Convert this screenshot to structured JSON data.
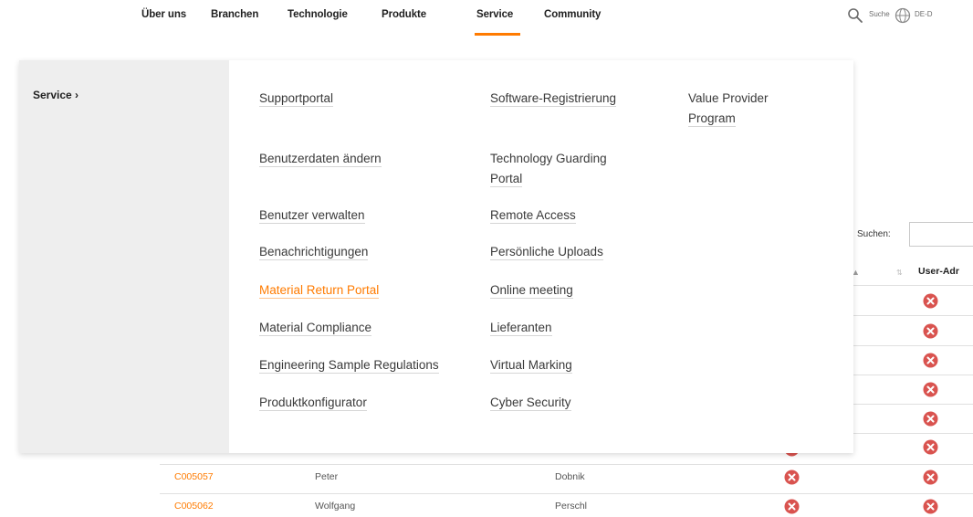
{
  "nav": {
    "items": [
      "Über uns",
      "Branchen",
      "Technologie",
      "Produkte",
      "Service",
      "Community"
    ],
    "active_item": "Service",
    "search_label": "Suche",
    "language_label": "DE-D"
  },
  "accent_color": "#ff7b00",
  "background_page": {
    "heading_fragment": "(",
    "side_fragment": "n",
    "search_label": "Suchen:",
    "column_header": "User-Adr",
    "rows": [
      {
        "id": "C005057",
        "first_name": "Peter",
        "last_name": "Dobnik"
      },
      {
        "id": "C005062",
        "first_name": "Wolfgang",
        "last_name": "Perschl"
      }
    ],
    "status_icon": "x-circle-icon"
  },
  "menu": {
    "side_title": "Service ›",
    "col1": [
      "Supportportal",
      "Benutzerdaten ändern",
      "Benutzer verwalten",
      "Benachrichtigungen",
      "Material Return Portal",
      "Material Compliance",
      "Engineering Sample Regulations",
      "Produktkonfigurator"
    ],
    "col2": [
      "Software-Registrierung",
      "Technology Guarding",
      "Portal",
      "Remote Access",
      "Persönliche Uploads",
      "Online meeting",
      "Lieferanten",
      "Virtual Marking",
      "Cyber Security"
    ],
    "col3": [
      "Value Provider",
      "Program"
    ],
    "active_link": "Material Return Portal"
  }
}
